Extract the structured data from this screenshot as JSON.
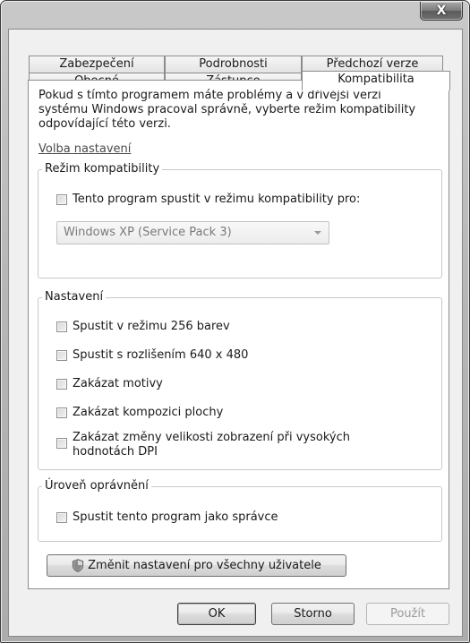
{
  "window": {
    "close_glyph": "X"
  },
  "tabs": {
    "row1": [
      "Zabezpečení",
      "Podrobnosti",
      "Předchozí verze"
    ],
    "row2": [
      "Obecné",
      "Zástupce",
      "Kompatibilita"
    ],
    "active": "Kompatibilita"
  },
  "panel": {
    "intro": "Pokud s tímto programem máte problémy a v dřívější verzi systému Windows pracoval správně, vyberte režim kompatibility odpovídající této verzi.",
    "help_link": "Volba nastavení",
    "compat_group": {
      "legend": "Režim kompatibility",
      "checkbox_label": "Tento program spustit v režimu kompatibility pro:",
      "checked": false,
      "select_value": "Windows XP (Service Pack 3)"
    },
    "settings_group": {
      "legend": "Nastavení",
      "items": [
        {
          "label": "Spustit v režimu 256 barev",
          "checked": false
        },
        {
          "label": "Spustit s rozlišením 640 x 480",
          "checked": false
        },
        {
          "label": "Zakázat motivy",
          "checked": false
        },
        {
          "label": "Zakázat kompozici plochy",
          "checked": false
        },
        {
          "label_line1": "Zakázat změny velikosti zobrazení při vysokých",
          "label_line2": "hodnotách DPI",
          "checked": false
        }
      ]
    },
    "privilege_group": {
      "legend": "Úroveň oprávnění",
      "checkbox_label": "Spustit tento program jako správce",
      "checked": false
    },
    "all_users_button": "Změnit nastavení pro všechny uživatele"
  },
  "buttons": {
    "ok": "OK",
    "cancel": "Storno",
    "apply": "Použít"
  },
  "colors": {
    "frame": "#b9b9b9",
    "client": "#f0f0f0",
    "panel": "#ffffff",
    "link": "#4a4a4a",
    "disabled_text": "#9a9a9a"
  }
}
